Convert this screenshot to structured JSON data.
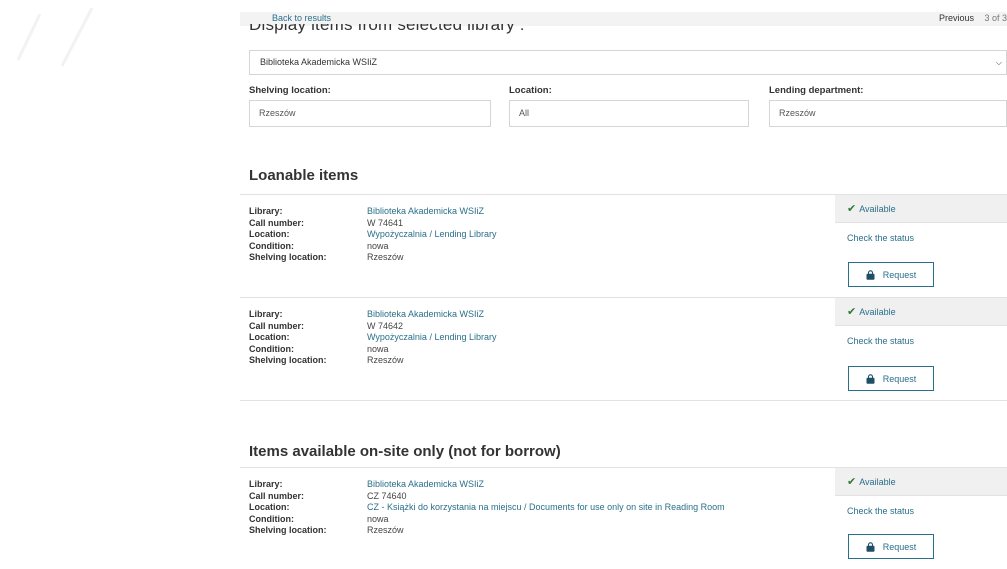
{
  "header": {
    "back_label": "Back to results",
    "prev_label": "Previous",
    "count_label": "3 of 3",
    "heading": "Display items from selected library :"
  },
  "library_select": {
    "value": "Biblioteka Akademicka WSIiZ"
  },
  "filters": {
    "shelving": {
      "label": "Shelving location:",
      "value": "Rzeszów"
    },
    "location": {
      "label": "Location:",
      "value": "All"
    },
    "lending": {
      "label": "Lending department:",
      "value": "Rzeszów"
    }
  },
  "field_labels": {
    "library": "Library:",
    "call_number": "Call number:",
    "location": "Location:",
    "condition": "Condition:",
    "shelving": "Shelving location:"
  },
  "sections": {
    "loanable": {
      "title": "Loanable items",
      "items": [
        {
          "library": "Biblioteka Akademicka WSIiZ",
          "call_number": "W 74641",
          "location": "Wypożyczalnia / Lending Library",
          "condition": "nowa",
          "shelving": "Rzeszów",
          "availability": "Available",
          "status_link": "Check the status",
          "request_label": "Request"
        },
        {
          "library": "Biblioteka Akademicka WSIiZ",
          "call_number": "W 74642",
          "location": "Wypożyczalnia / Lending Library",
          "condition": "nowa",
          "shelving": "Rzeszów",
          "availability": "Available",
          "status_link": "Check the status",
          "request_label": "Request"
        }
      ]
    },
    "onsite": {
      "title": "Items available on-site only (not for borrow)",
      "items": [
        {
          "library": "Biblioteka Akademicka WSIiZ",
          "call_number": "CZ 74640",
          "location": "CZ - Książki do korzystania na miejscu / Documents for use only on site in Reading Room",
          "condition": "nowa",
          "shelving": "Rzeszów",
          "availability": "Available",
          "status_link": "Check the status",
          "request_label": "Request"
        }
      ]
    }
  },
  "icons": {
    "check": "check-icon",
    "request": "bag-lock-icon",
    "chevron": "chevron-down-icon"
  },
  "colors": {
    "link": "#2a6f8a",
    "available_check": "#2e7d32",
    "panel_bg": "#f0f0f0"
  }
}
